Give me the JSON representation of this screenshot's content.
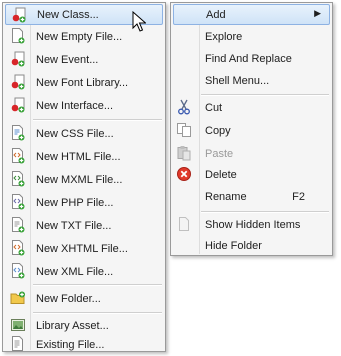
{
  "new_submenu": {
    "items": [
      {
        "label": "New Class...",
        "icon": "class-icon",
        "highlighted": true
      },
      {
        "label": "New Empty File...",
        "icon": "empty-file-icon"
      },
      {
        "label": "New Event...",
        "icon": "event-icon"
      },
      {
        "label": "New Font Library...",
        "icon": "font-library-icon"
      },
      {
        "label": "New Interface...",
        "icon": "interface-icon"
      },
      {
        "label": "New CSS File...",
        "icon": "css-file-icon"
      },
      {
        "label": "New HTML File...",
        "icon": "html-file-icon"
      },
      {
        "label": "New MXML File...",
        "icon": "mxml-file-icon"
      },
      {
        "label": "New PHP File...",
        "icon": "php-file-icon"
      },
      {
        "label": "New TXT File...",
        "icon": "txt-file-icon"
      },
      {
        "label": "New XHTML File...",
        "icon": "xhtml-file-icon"
      },
      {
        "label": "New XML File...",
        "icon": "xml-file-icon"
      },
      {
        "label": "New Folder...",
        "icon": "new-folder-icon"
      },
      {
        "label": "Library Asset...",
        "icon": "library-asset-icon"
      },
      {
        "label": "Existing File...",
        "icon": "existing-file-icon"
      }
    ]
  },
  "context_menu": {
    "items": [
      {
        "label": "Add",
        "has_submenu": true,
        "highlighted": true
      },
      {
        "label": "Explore"
      },
      {
        "label": "Find And Replace"
      },
      {
        "label": "Shell Menu..."
      },
      {
        "label": "Cut",
        "icon": "scissors-icon"
      },
      {
        "label": "Copy",
        "icon": "copy-icon"
      },
      {
        "label": "Paste",
        "icon": "paste-icon",
        "disabled": true
      },
      {
        "label": "Delete",
        "icon": "delete-icon"
      },
      {
        "label": "Rename",
        "shortcut": "F2"
      },
      {
        "label": "Show Hidden Items",
        "icon": "show-hidden-icon"
      },
      {
        "label": "Hide Folder"
      }
    ]
  },
  "colors": {
    "highlight_border": "#8db2e3",
    "highlight_fill": "#cfe3f7",
    "menu_background": "#f5f5f5",
    "disabled_text": "#9a9a9a"
  }
}
